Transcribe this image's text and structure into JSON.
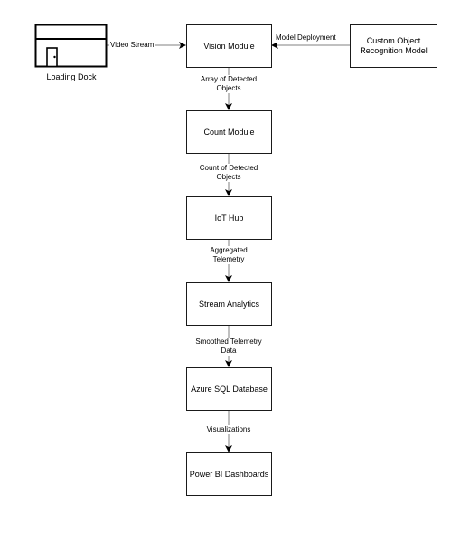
{
  "diagram": {
    "nodes": {
      "loading_dock": "Loading Dock",
      "vision_module": "Vision Module",
      "custom_model": "Custom Object Recognition Model",
      "count_module": "Count Module",
      "iot_hub": "IoT Hub",
      "stream_analytics": "Stream Analytics",
      "azure_sql": "Azure SQL Database",
      "power_bi": "Power BI Dashboards"
    },
    "edges": {
      "video_stream": "Video Stream",
      "model_deployment": "Model Deployment",
      "array_detected": "Array of Detected Objects",
      "count_detected": "Count of Detected Objects",
      "aggregated": "Aggregated Telemetry",
      "smoothed": "Smoothed Telemetry Data",
      "visualizations": "Visualizations"
    },
    "colors": {
      "stroke": "#1a1a1a",
      "connector": "#808080",
      "background": "#ffffff"
    }
  }
}
